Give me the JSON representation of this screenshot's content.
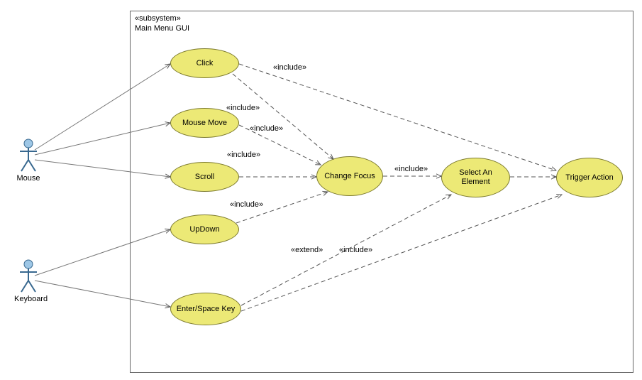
{
  "boundary": {
    "stereotype": "«subsystem»",
    "name": "Main Menu GUI"
  },
  "actors": {
    "mouse": "Mouse",
    "keyboard": "Keyboard"
  },
  "usecases": {
    "click": "Click",
    "mouse_move": "Mouse Move",
    "scroll": "Scroll",
    "updown": "UpDown",
    "enter_space": "Enter/Space Key",
    "change_focus": "Change Focus",
    "select_element": "Select An Element",
    "trigger_action": "Trigger Action"
  },
  "relations": {
    "include": "«include»",
    "extend": "«extend»"
  },
  "edge_labels": {
    "click_trigger": "«include»",
    "click_change": "«include»",
    "mousemove_change": "«include»",
    "scroll_change": "«include»",
    "updown_change": "«include»",
    "change_select": "«include»",
    "enter_select": "«include»",
    "enter_trigger": "«extend»"
  }
}
